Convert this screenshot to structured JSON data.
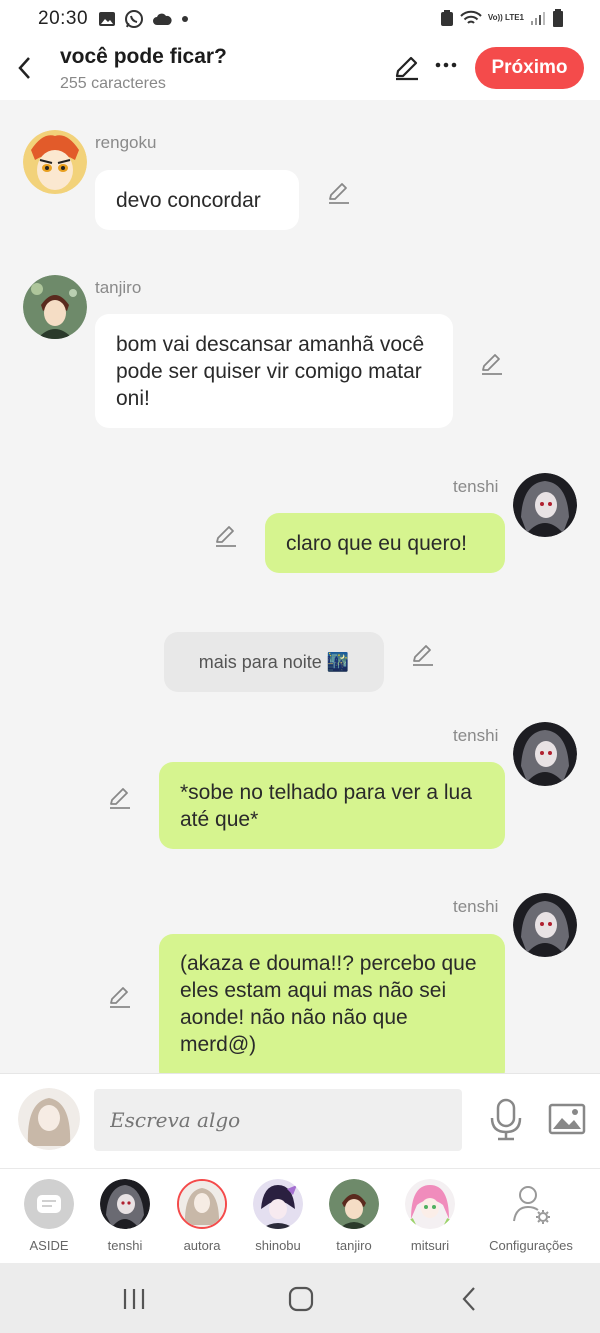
{
  "status_bar": {
    "time": "20:30",
    "network": "Vo)) LTE1"
  },
  "header": {
    "title": "você pode ficar?",
    "subtitle": "255 caracteres",
    "next_label": "Próximo"
  },
  "messages": [
    {
      "user": "rengoku",
      "text": "devo concordar"
    },
    {
      "user": "tanjiro",
      "text": "bom vai  descansar amanhã você pode ser quiser vir comigo matar oni!"
    },
    {
      "user": "tenshi",
      "text": "claro que eu quero!"
    },
    {
      "narration": "mais para noite 🌃"
    },
    {
      "user": "tenshi",
      "text": "*sobe no telhado para ver a lua até que*"
    },
    {
      "user": "tenshi",
      "text": "(akaza e douma!!? percebo que eles estam aqui mas não sei aonde! não não não que merd@)"
    }
  ],
  "input": {
    "placeholder": "Escreva algo"
  },
  "characters": [
    {
      "label": "ASIDE"
    },
    {
      "label": "tenshi"
    },
    {
      "label": "autora"
    },
    {
      "label": "shinobu"
    },
    {
      "label": "tanjiro"
    },
    {
      "label": "mitsuri"
    },
    {
      "label": "Configurações"
    }
  ],
  "colors": {
    "accent": "#f44b4b",
    "own_bubble": "#d6f48f",
    "other_bubble": "#ffffff",
    "narration_bubble": "#e8e8e8",
    "background": "#f4f4f4"
  },
  "icons": [
    "back-arrow-icon",
    "edit-pencil-icon",
    "more-dots-icon",
    "microphone-icon",
    "image-icon",
    "chat-bubble-icon",
    "settings-person-icon"
  ]
}
